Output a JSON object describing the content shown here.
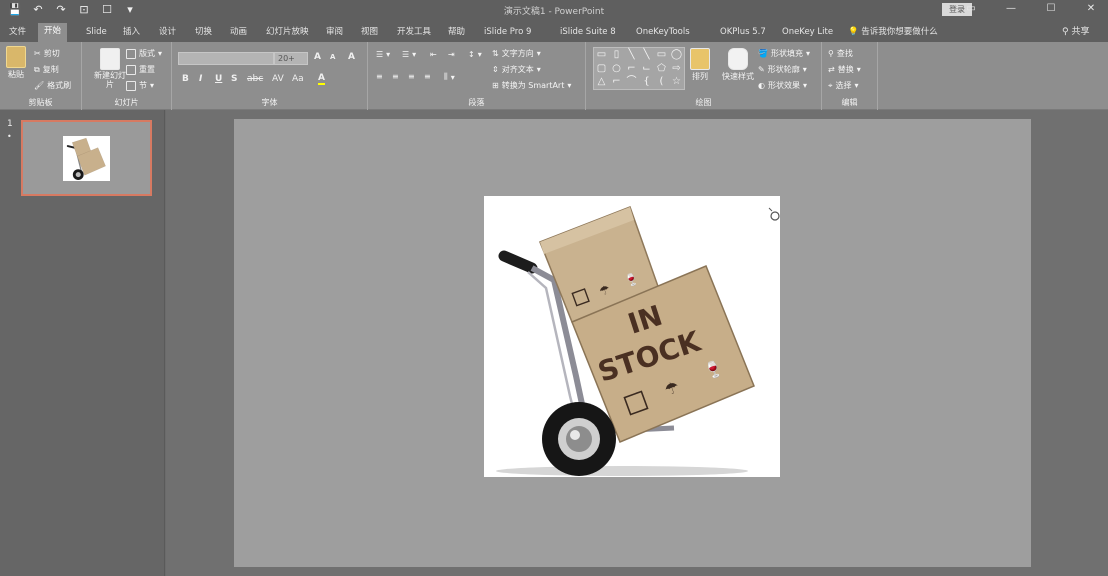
{
  "title_bar": {
    "document_title": "演示文稿1 - PowerPoint",
    "sign_in_label": "登录",
    "quick_access": {
      "save_icon": "save-icon",
      "undo_icon": "undo-icon",
      "redo_icon": "redo-icon",
      "start_from_beginning_icon": "slideshow-icon",
      "touch_mode_icon": "touch-mode-icon",
      "customize_icon": "customize-icon"
    },
    "window_controls": {
      "ribbon_display_icon": "ribbon-display-icon",
      "minimize_icon": "minimize-icon",
      "maximize_icon": "maximize-icon",
      "close_icon": "close-icon"
    }
  },
  "tabs": [
    {
      "label": "文件"
    },
    {
      "label": "开始",
      "active": true
    },
    {
      "label": "Slide"
    },
    {
      "label": "插入"
    },
    {
      "label": "设计"
    },
    {
      "label": "切换"
    },
    {
      "label": "动画"
    },
    {
      "label": "幻灯片放映"
    },
    {
      "label": "审阅"
    },
    {
      "label": "视图"
    },
    {
      "label": "开发工具"
    },
    {
      "label": "帮助"
    },
    {
      "label": "iSlide Pro 9"
    },
    {
      "label": "iSlide Suite 8"
    },
    {
      "label": "OneKeyTools"
    },
    {
      "label": "OKPlus 5.7"
    },
    {
      "label": "OneKey Lite"
    },
    {
      "label": "告诉我你想要做什么"
    }
  ],
  "share_label": "共享",
  "ribbon": {
    "clipboard": {
      "label": "剪贴板",
      "paste": "粘贴",
      "cut": "剪切",
      "copy": "复制",
      "format_painter": "格式刷"
    },
    "slides": {
      "label": "幻灯片",
      "new_slide": "新建幻灯片",
      "layout": "版式",
      "reset": "重置",
      "section": "节"
    },
    "font": {
      "label": "字体",
      "font_name": "",
      "font_size": "20+",
      "bold": "B",
      "italic": "I",
      "underline": "U",
      "shadow": "S",
      "strikethrough": "abc",
      "spacing": "AV",
      "case": "Aa",
      "increase": "A",
      "decrease": "A",
      "clear": "A",
      "color": "A"
    },
    "paragraph": {
      "label": "段落",
      "text_direction": "文字方向",
      "align_text": "对齐文本",
      "convert_smartart": "转换为 SmartArt"
    },
    "drawing": {
      "label": "绘图",
      "arrange": "排列",
      "quick_styles": "快速样式",
      "shape_fill": "形状填充",
      "shape_outline": "形状轮廓",
      "shape_effects": "形状效果"
    },
    "editing": {
      "label": "编辑",
      "find": "查找",
      "replace": "替换",
      "select": "选择"
    }
  },
  "thumbnails": [
    {
      "number": "1",
      "star": "•"
    }
  ],
  "slide": {
    "picture_text_line1": "IN",
    "picture_text_line2": "STOCK",
    "picture_icon": "hand-truck-boxes-illustration"
  },
  "colors": {
    "thumbnail_selected_border": "#d77a62",
    "box_tan": "#c8b08c",
    "box_text": "#4a3022"
  }
}
